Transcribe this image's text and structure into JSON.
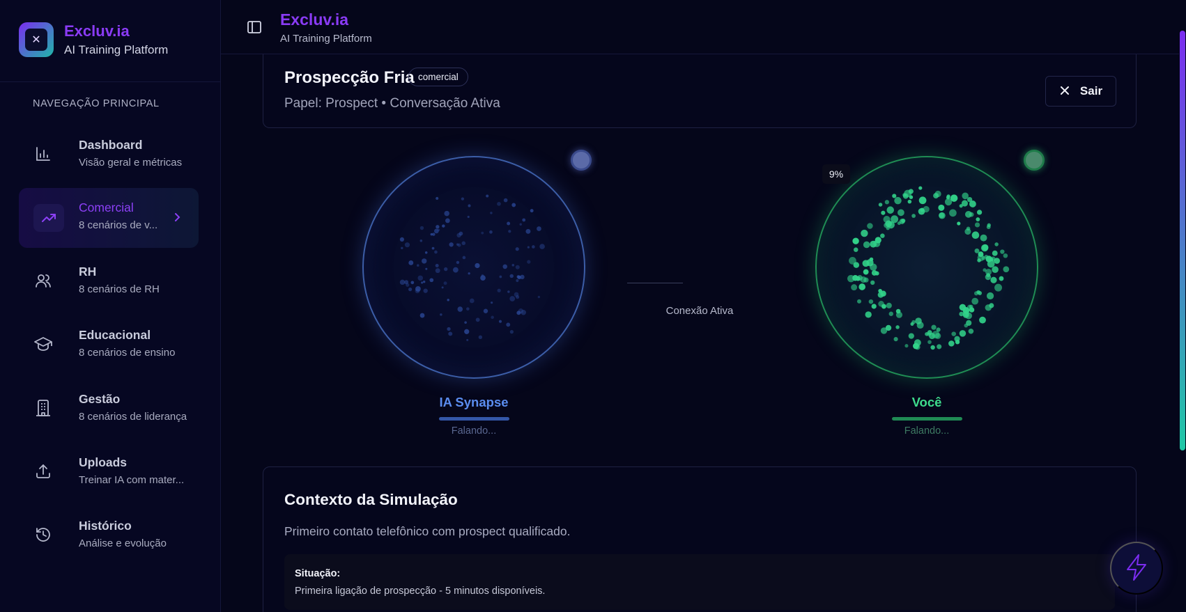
{
  "brand": {
    "logo_glyph": "✕",
    "name": "Excluv.ia",
    "subtitle": "AI Training Platform"
  },
  "nav": {
    "section_title": "NAVEGAÇÃO PRINCIPAL",
    "items": [
      {
        "label": "Dashboard",
        "desc": "Visão geral e métricas",
        "icon": "bar-chart-icon",
        "active": false
      },
      {
        "label": "Comercial",
        "desc": "8 cenários de v...",
        "icon": "trending-up-icon",
        "active": true
      },
      {
        "label": "RH",
        "desc": "8 cenários de RH",
        "icon": "users-icon",
        "active": false
      },
      {
        "label": "Educacional",
        "desc": "8 cenários de ensino",
        "icon": "graduation-cap-icon",
        "active": false
      },
      {
        "label": "Gestão",
        "desc": "8 cenários de liderança",
        "icon": "building-icon",
        "active": false
      },
      {
        "label": "Uploads",
        "desc": "Treinar IA com mater...",
        "icon": "upload-icon",
        "active": false
      },
      {
        "label": "Histórico",
        "desc": "Análise e evolução",
        "icon": "history-icon",
        "active": false
      }
    ]
  },
  "header": {
    "title": "Excluv.ia",
    "subtitle": "AI Training Platform"
  },
  "scenario": {
    "title": "Prospecção Fria",
    "badge": "comercial",
    "subtitle": "Papel: Prospect • Conversação Ativa",
    "exit_label": "Sair"
  },
  "conversation": {
    "ai": {
      "name": "IA Synapse",
      "state": "Falando..."
    },
    "user": {
      "name": "Você",
      "state": "Falando...",
      "level_badge": "9%"
    },
    "connection_label": "Conexão Ativa"
  },
  "context": {
    "title": "Contexto da Simulação",
    "description": "Primeiro contato telefônico com prospect qualificado.",
    "situation_label": "Situação:",
    "situation_text": "Primeira ligação de prospecção - 5 minutos disponíveis."
  },
  "colors": {
    "brand_purple": "#8a3bf5",
    "ai_blue": "#5b8df0",
    "user_green": "#3edb8c",
    "background": "#05061a"
  }
}
